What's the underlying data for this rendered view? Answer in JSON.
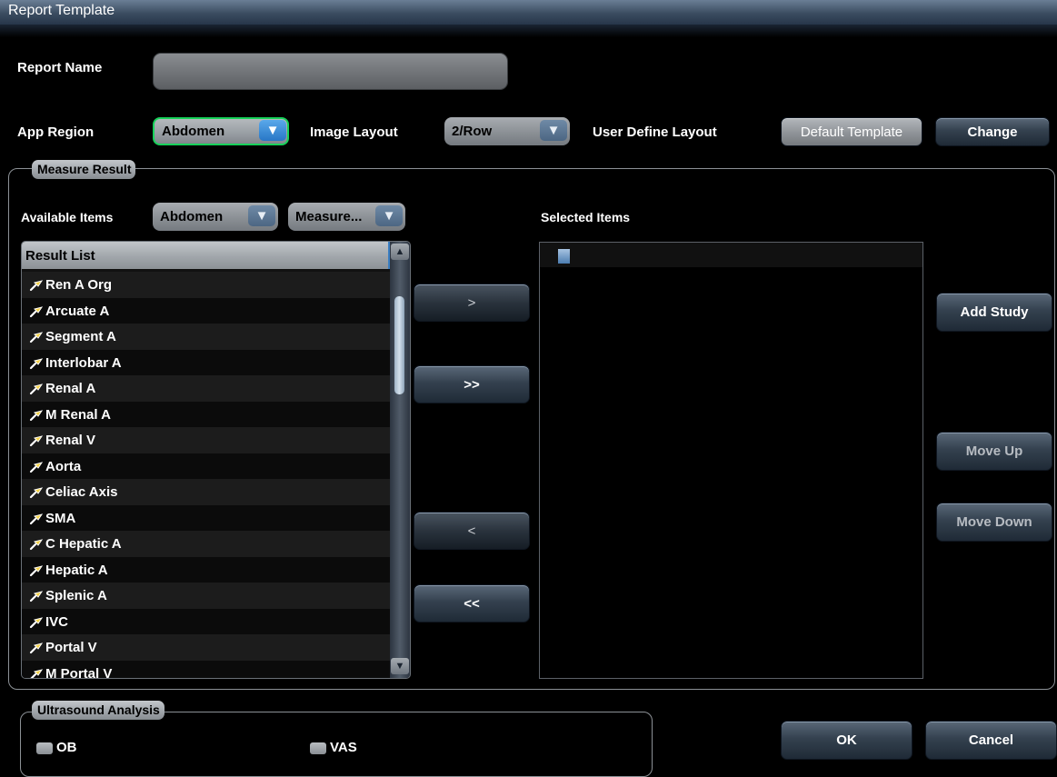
{
  "window": {
    "title": "Report Template"
  },
  "report_name": {
    "label": "Report Name",
    "value": ""
  },
  "app_region": {
    "label": "App Region",
    "value": "Abdomen"
  },
  "image_layout": {
    "label": "Image Layout",
    "value": "2/Row"
  },
  "user_define_layout": {
    "label": "User Define Layout",
    "value": "Default Template",
    "change_label": "Change"
  },
  "measure_result": {
    "caption": "Measure Result",
    "available_label": "Available Items",
    "available_region": "Abdomen",
    "available_type": "Measure...",
    "selected_label": "Selected Items",
    "result_list": {
      "header": "Result List",
      "items": [
        "Ren A Org",
        "Arcuate A",
        "Segment A",
        "Interlobar A",
        "Renal A",
        "M Renal A",
        "Renal V",
        "Aorta",
        "Celiac Axis",
        "SMA",
        "C Hepatic A",
        "Hepatic A",
        "Splenic A",
        "IVC",
        "Portal V",
        "M Portal V"
      ]
    },
    "buttons": {
      "add_one": ">",
      "add_all": ">>",
      "remove_one": "<",
      "remove_all": "<<"
    },
    "side_buttons": {
      "add_study": "Add Study",
      "move_up": "Move Up",
      "move_down": "Move Down"
    }
  },
  "ultrasound_analysis": {
    "caption": "Ultrasound Analysis",
    "options": [
      {
        "label": "OB",
        "checked": false
      },
      {
        "label": "VAS",
        "checked": false
      }
    ]
  },
  "footer": {
    "ok": "OK",
    "cancel": "Cancel"
  },
  "colors": {
    "accent_green": "#17d25a",
    "accent_blue": "#2877c6",
    "background": "#000000"
  }
}
